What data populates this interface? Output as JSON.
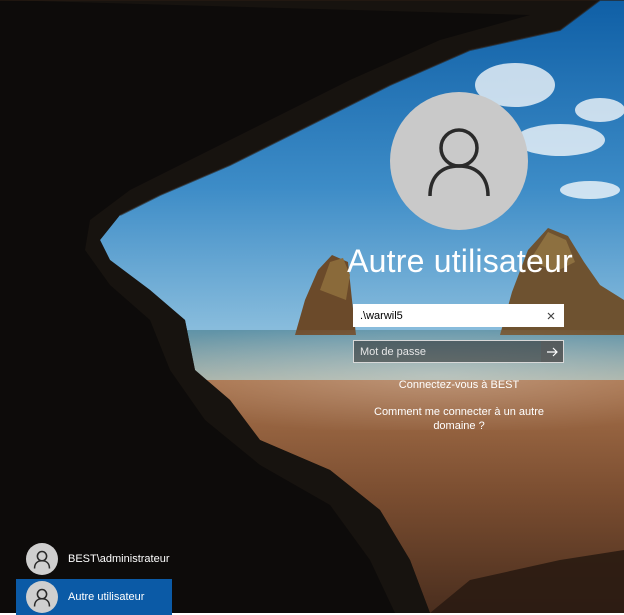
{
  "login": {
    "title": "Autre utilisateur",
    "username_value": ".\\warwil5",
    "password_placeholder": "Mot de passe",
    "connect_link": "Connectez-vous à BEST",
    "other_domain_link": "Comment me connecter à un autre domaine ?"
  },
  "icons": {
    "avatar": "user-icon",
    "clear": "close-icon",
    "submit": "arrow-right-icon"
  },
  "users": [
    {
      "label": "BEST\\administrateur",
      "selected": false
    },
    {
      "label": "Autre utilisateur",
      "selected": true
    }
  ],
  "colors": {
    "selected_user": "#0b5aa6",
    "avatar": "#c9c9c9"
  }
}
